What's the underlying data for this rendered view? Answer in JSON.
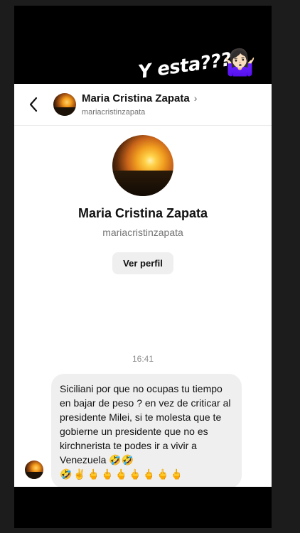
{
  "overlay": {
    "caption": "Y esta???",
    "emoji": "🤷🏻‍♀️"
  },
  "header": {
    "name": "Maria Cristina Zapata",
    "chevron": "›",
    "username": "mariacristinzapata"
  },
  "profile": {
    "name": "Maria Cristina Zapata",
    "username": "mariacristinzapata",
    "view_button": "Ver perfil"
  },
  "conversation": {
    "timestamp": "16:41",
    "message": {
      "text": "Siciliani por que no ocupas tu tiempo en bajar de peso ? en vez de criticar al presidente Milei, si te molesta que te gobierne un presidente que no es kirchnerista te podes ir a vivir a Venezuela 🤣🤣",
      "emojis": "🤣✌️🖕🖕🖕🖕🖕🖕🖕"
    }
  },
  "icons": {
    "back": "chevron-left-icon",
    "profile_chevron": "chevron-right-icon"
  }
}
